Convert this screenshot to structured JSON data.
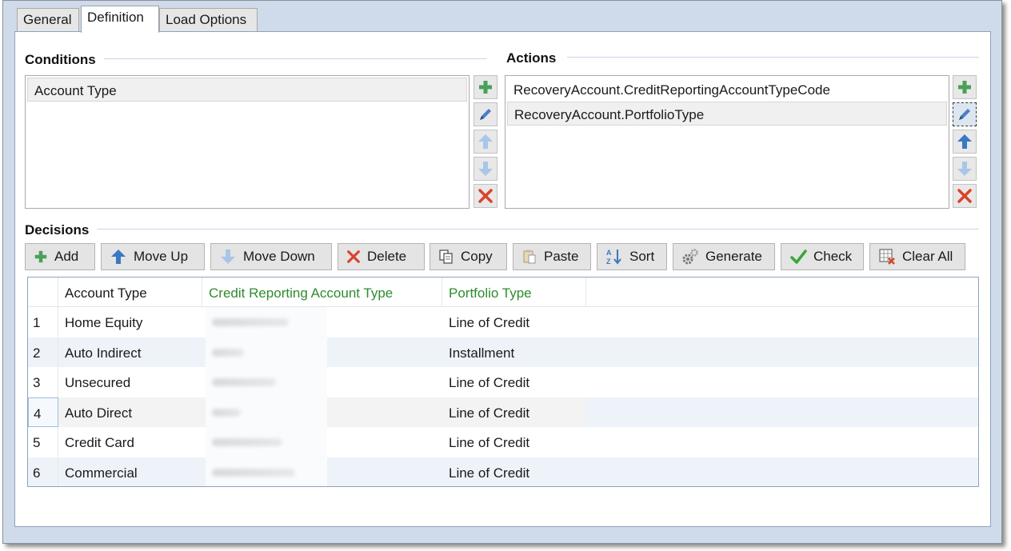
{
  "tabs": [
    {
      "label": "General",
      "active": false
    },
    {
      "label": "Definition",
      "active": true
    },
    {
      "label": "Load Options",
      "active": false
    }
  ],
  "conditions": {
    "title": "Conditions",
    "items": [
      "Account Type"
    ]
  },
  "actions": {
    "title": "Actions",
    "items": [
      "RecoveryAccount.CreditReportingAccountTypeCode",
      "RecoveryAccount.PortfolioType"
    ]
  },
  "side_buttons": [
    "plus-icon",
    "pencil-icon",
    "arrow-up-icon",
    "arrow-down-icon",
    "delete-x-icon"
  ],
  "decisions": {
    "title": "Decisions",
    "toolbar": {
      "add": "Add",
      "move_up": "Move Up",
      "move_down": "Move Down",
      "delete": "Delete",
      "copy": "Copy",
      "paste": "Paste",
      "sort": "Sort",
      "generate": "Generate",
      "check": "Check",
      "clear_all": "Clear All"
    },
    "columns": [
      "Account Type",
      "Credit Reporting Account Type",
      "Portfolio Type"
    ],
    "rows": [
      {
        "num": "1",
        "account_type": "Home Equity",
        "portfolio_type": "Line of Credit"
      },
      {
        "num": "2",
        "account_type": "Auto Indirect",
        "portfolio_type": "Installment"
      },
      {
        "num": "3",
        "account_type": "Unsecured",
        "portfolio_type": "Line of Credit"
      },
      {
        "num": "4",
        "account_type": "Auto Direct",
        "portfolio_type": "Line of Credit"
      },
      {
        "num": "5",
        "account_type": "Credit Card",
        "portfolio_type": "Line of Credit"
      },
      {
        "num": "6",
        "account_type": "Commercial",
        "portfolio_type": "Line of Credit"
      }
    ]
  },
  "colors": {
    "green_header": "#2e8b2e",
    "add_green": "#4aa05a",
    "arrow_blue": "#3a78c2",
    "delete_red": "#d9432b",
    "window_bg": "#cfdbea"
  }
}
